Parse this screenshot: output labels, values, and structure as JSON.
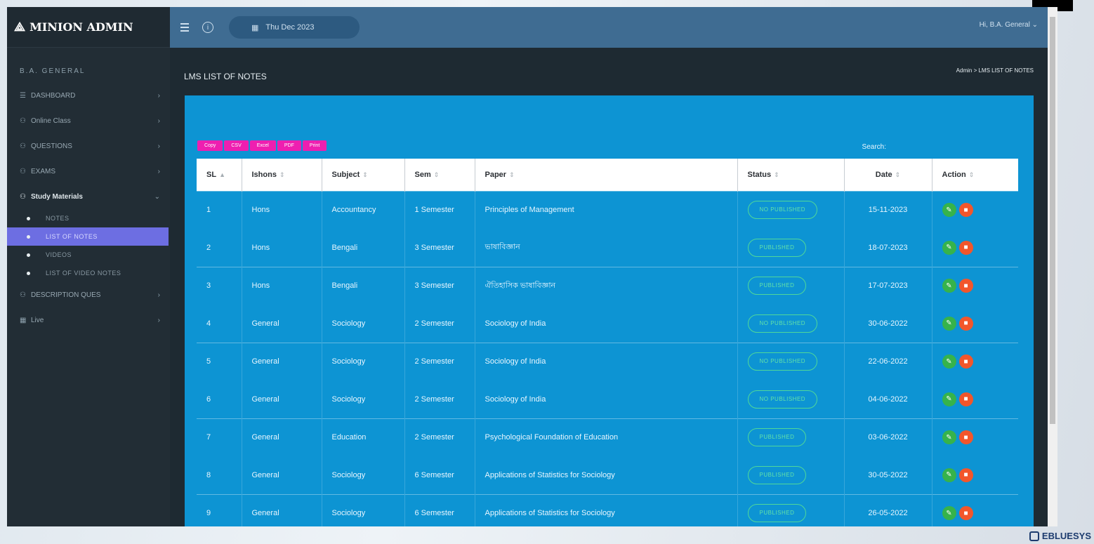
{
  "app": {
    "brand": "MINION ADMIN"
  },
  "topbar": {
    "date": "Thu Dec 2023",
    "user": "Hi, B.A. General"
  },
  "sidebar": {
    "section": "B.A. GENERAL",
    "items": [
      {
        "icon": "list-icon",
        "label": "DASHBOARD"
      },
      {
        "icon": "users-icon",
        "label": "Online Class"
      },
      {
        "icon": "users-icon",
        "label": "QUESTIONS"
      },
      {
        "icon": "users-icon",
        "label": "EXAMS"
      },
      {
        "icon": "users-icon",
        "label": "Study Materials"
      },
      {
        "icon": "users-icon",
        "label": "DESCRIPTION QUES"
      },
      {
        "icon": "grid-icon",
        "label": "Live"
      }
    ],
    "sub_items": [
      {
        "label": "NOTES",
        "active": false
      },
      {
        "label": "LIST OF NOTES",
        "active": true
      },
      {
        "label": "VIDEOS",
        "active": false
      },
      {
        "label": "LIST OF VIDEO NOTES",
        "active": false
      }
    ]
  },
  "page": {
    "title": "LMS LIST OF NOTES",
    "breadcrumb": "Admin > LMS LIST OF NOTES"
  },
  "toolbar": {
    "export_buttons": [
      "Copy",
      "CSV",
      "Excel",
      "PDF",
      "Print"
    ],
    "search_label": "Search:"
  },
  "table": {
    "headers": [
      "SL",
      "Ishons",
      "Subject",
      "Sem",
      "Paper",
      "Status",
      "Date",
      "Action"
    ],
    "sort_marks": [
      "▲",
      "⇕",
      "⇕",
      "⇕",
      "⇕",
      "⇕",
      "⇕",
      "⇕"
    ],
    "rows": [
      [
        "1",
        "Hons",
        "Accountancy",
        "1 Semester",
        "Principles of Management",
        "NO PUBLISHED",
        "15-11-2023"
      ],
      [
        "2",
        "Hons",
        "Bengali",
        "3 Semester",
        "ভাষাবিজ্ঞান",
        "PUBLISHED",
        "18-07-2023"
      ],
      [
        "3",
        "Hons",
        "Bengali",
        "3 Semester",
        "ঐতিহাসিক ভাষাবিজ্ঞান",
        "PUBLISHED",
        "17-07-2023"
      ],
      [
        "4",
        "General",
        "Sociology",
        "2 Semester",
        "Sociology of India",
        "NO PUBLISHED",
        "30-06-2022"
      ],
      [
        "5",
        "General",
        "Sociology",
        "2 Semester",
        "Sociology of India",
        "NO PUBLISHED",
        "22-06-2022"
      ],
      [
        "6",
        "General",
        "Sociology",
        "2 Semester",
        "Sociology of India",
        "NO PUBLISHED",
        "04-06-2022"
      ],
      [
        "7",
        "General",
        "Education",
        "2 Semester",
        "Psychological Foundation of Education",
        "PUBLISHED",
        "03-06-2022"
      ],
      [
        "8",
        "General",
        "Sociology",
        "6 Semester",
        "Applications of Statistics for Sociology",
        "PUBLISHED",
        "30-05-2022"
      ],
      [
        "9",
        "General",
        "Sociology",
        "6 Semester",
        "Applications of Statistics for Sociology",
        "PUBLISHED",
        "26-05-2022"
      ]
    ]
  },
  "watermark": "EBLUESYS",
  "colors": {
    "topbar": "#3f6c92",
    "panel": "#0d94d3",
    "sidebar_active": "#6d6ee2",
    "export_button": "#ee1fb0",
    "edit_button": "#36b34b",
    "delete_button": "#f2562b"
  }
}
